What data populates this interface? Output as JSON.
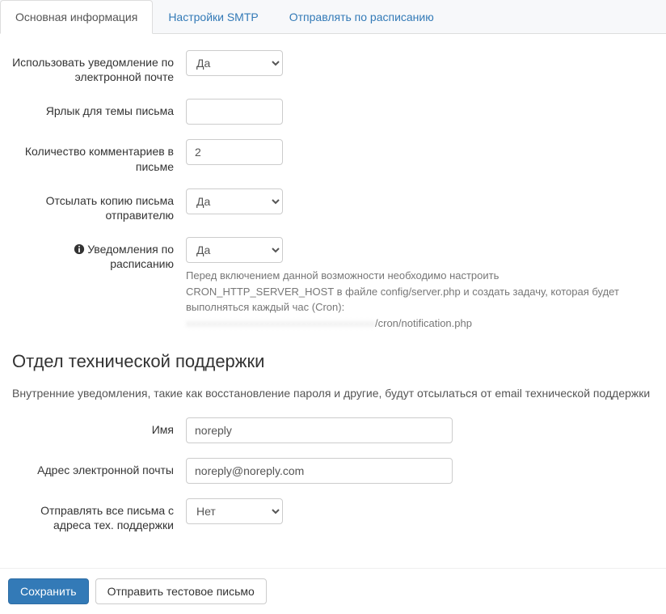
{
  "tabs": [
    {
      "label": "Основная информация",
      "active": true
    },
    {
      "label": "Настройки SMTP",
      "active": false
    },
    {
      "label": "Отправлять по расписанию",
      "active": false
    }
  ],
  "main": {
    "use_email_notification": {
      "label": "Использовать уведомление по электронной почте",
      "value": "Да"
    },
    "subject_prefix": {
      "label": "Ярлык для темы письма",
      "value": ""
    },
    "comments_count": {
      "label": "Количество комментариев в письме",
      "value": "2"
    },
    "send_copy": {
      "label": "Отсылать копию письма отправителю",
      "value": "Да"
    },
    "scheduled": {
      "label": "Уведомления по расписанию",
      "value": "Да",
      "help_line1": "Перед включением данной возможности необходимо настроить CRON_HTTP_SERVER_HOST в файле config/server.php и создать задачу, которая будет выполняться каждый час (Cron):",
      "help_blurred": "xxxxxxxxxxxxxxxxxxxxxxxxxxxxxxxxxxxx",
      "help_tail": "/cron/notification.php"
    }
  },
  "support": {
    "title": "Отдел технической поддержки",
    "desc": "Внутренние уведомления, такие как восстановление пароля и другие, будут отсылаться от email технической поддержки",
    "name": {
      "label": "Имя",
      "value": "noreply"
    },
    "email": {
      "label": "Адрес электронной почты",
      "value": "noreply@noreply.com"
    },
    "send_all_from_support": {
      "label": "Отправлять все письма с адреса тех. поддержки",
      "value": "Нет"
    }
  },
  "footer": {
    "save": "Сохранить",
    "send_test": "Отправить тестовое письмо"
  },
  "options": {
    "yes_no": [
      "Да",
      "Нет"
    ]
  }
}
